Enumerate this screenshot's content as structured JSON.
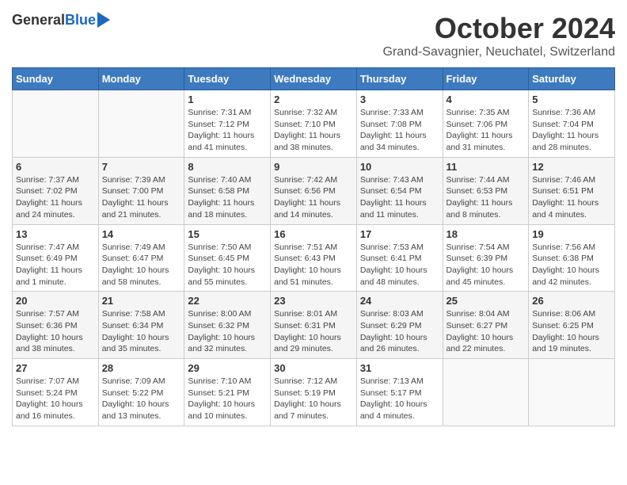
{
  "header": {
    "logo_general": "General",
    "logo_blue": "Blue",
    "month_title": "October 2024",
    "subtitle": "Grand-Savagnier, Neuchatel, Switzerland"
  },
  "days_of_week": [
    "Sunday",
    "Monday",
    "Tuesday",
    "Wednesday",
    "Thursday",
    "Friday",
    "Saturday"
  ],
  "weeks": [
    [
      {
        "day": "",
        "info": ""
      },
      {
        "day": "",
        "info": ""
      },
      {
        "day": "1",
        "info": "Sunrise: 7:31 AM\nSunset: 7:12 PM\nDaylight: 11 hours and 41 minutes."
      },
      {
        "day": "2",
        "info": "Sunrise: 7:32 AM\nSunset: 7:10 PM\nDaylight: 11 hours and 38 minutes."
      },
      {
        "day": "3",
        "info": "Sunrise: 7:33 AM\nSunset: 7:08 PM\nDaylight: 11 hours and 34 minutes."
      },
      {
        "day": "4",
        "info": "Sunrise: 7:35 AM\nSunset: 7:06 PM\nDaylight: 11 hours and 31 minutes."
      },
      {
        "day": "5",
        "info": "Sunrise: 7:36 AM\nSunset: 7:04 PM\nDaylight: 11 hours and 28 minutes."
      }
    ],
    [
      {
        "day": "6",
        "info": "Sunrise: 7:37 AM\nSunset: 7:02 PM\nDaylight: 11 hours and 24 minutes."
      },
      {
        "day": "7",
        "info": "Sunrise: 7:39 AM\nSunset: 7:00 PM\nDaylight: 11 hours and 21 minutes."
      },
      {
        "day": "8",
        "info": "Sunrise: 7:40 AM\nSunset: 6:58 PM\nDaylight: 11 hours and 18 minutes."
      },
      {
        "day": "9",
        "info": "Sunrise: 7:42 AM\nSunset: 6:56 PM\nDaylight: 11 hours and 14 minutes."
      },
      {
        "day": "10",
        "info": "Sunrise: 7:43 AM\nSunset: 6:54 PM\nDaylight: 11 hours and 11 minutes."
      },
      {
        "day": "11",
        "info": "Sunrise: 7:44 AM\nSunset: 6:53 PM\nDaylight: 11 hours and 8 minutes."
      },
      {
        "day": "12",
        "info": "Sunrise: 7:46 AM\nSunset: 6:51 PM\nDaylight: 11 hours and 4 minutes."
      }
    ],
    [
      {
        "day": "13",
        "info": "Sunrise: 7:47 AM\nSunset: 6:49 PM\nDaylight: 11 hours and 1 minute."
      },
      {
        "day": "14",
        "info": "Sunrise: 7:49 AM\nSunset: 6:47 PM\nDaylight: 10 hours and 58 minutes."
      },
      {
        "day": "15",
        "info": "Sunrise: 7:50 AM\nSunset: 6:45 PM\nDaylight: 10 hours and 55 minutes."
      },
      {
        "day": "16",
        "info": "Sunrise: 7:51 AM\nSunset: 6:43 PM\nDaylight: 10 hours and 51 minutes."
      },
      {
        "day": "17",
        "info": "Sunrise: 7:53 AM\nSunset: 6:41 PM\nDaylight: 10 hours and 48 minutes."
      },
      {
        "day": "18",
        "info": "Sunrise: 7:54 AM\nSunset: 6:39 PM\nDaylight: 10 hours and 45 minutes."
      },
      {
        "day": "19",
        "info": "Sunrise: 7:56 AM\nSunset: 6:38 PM\nDaylight: 10 hours and 42 minutes."
      }
    ],
    [
      {
        "day": "20",
        "info": "Sunrise: 7:57 AM\nSunset: 6:36 PM\nDaylight: 10 hours and 38 minutes."
      },
      {
        "day": "21",
        "info": "Sunrise: 7:58 AM\nSunset: 6:34 PM\nDaylight: 10 hours and 35 minutes."
      },
      {
        "day": "22",
        "info": "Sunrise: 8:00 AM\nSunset: 6:32 PM\nDaylight: 10 hours and 32 minutes."
      },
      {
        "day": "23",
        "info": "Sunrise: 8:01 AM\nSunset: 6:31 PM\nDaylight: 10 hours and 29 minutes."
      },
      {
        "day": "24",
        "info": "Sunrise: 8:03 AM\nSunset: 6:29 PM\nDaylight: 10 hours and 26 minutes."
      },
      {
        "day": "25",
        "info": "Sunrise: 8:04 AM\nSunset: 6:27 PM\nDaylight: 10 hours and 22 minutes."
      },
      {
        "day": "26",
        "info": "Sunrise: 8:06 AM\nSunset: 6:25 PM\nDaylight: 10 hours and 19 minutes."
      }
    ],
    [
      {
        "day": "27",
        "info": "Sunrise: 7:07 AM\nSunset: 5:24 PM\nDaylight: 10 hours and 16 minutes."
      },
      {
        "day": "28",
        "info": "Sunrise: 7:09 AM\nSunset: 5:22 PM\nDaylight: 10 hours and 13 minutes."
      },
      {
        "day": "29",
        "info": "Sunrise: 7:10 AM\nSunset: 5:21 PM\nDaylight: 10 hours and 10 minutes."
      },
      {
        "day": "30",
        "info": "Sunrise: 7:12 AM\nSunset: 5:19 PM\nDaylight: 10 hours and 7 minutes."
      },
      {
        "day": "31",
        "info": "Sunrise: 7:13 AM\nSunset: 5:17 PM\nDaylight: 10 hours and 4 minutes."
      },
      {
        "day": "",
        "info": ""
      },
      {
        "day": "",
        "info": ""
      }
    ]
  ]
}
